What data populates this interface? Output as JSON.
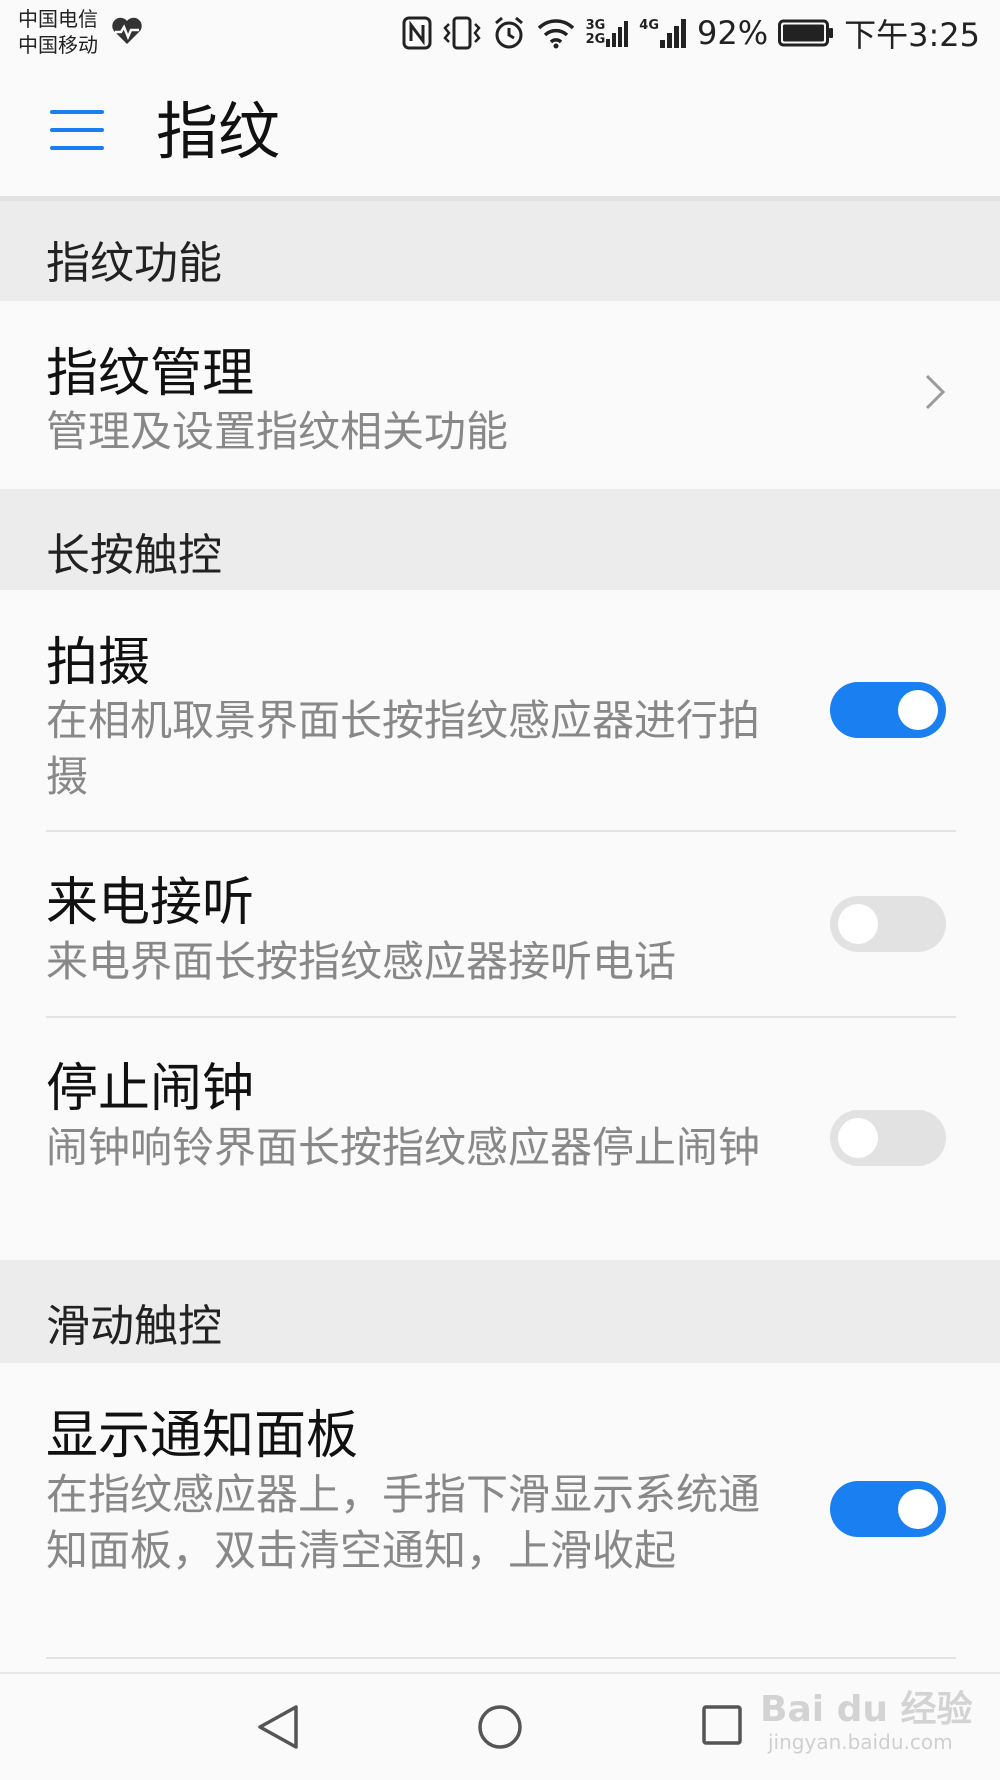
{
  "status_bar": {
    "carrier1": "中国电信",
    "carrier2": "中国移动",
    "net1": "3G",
    "net2": "2G",
    "net3": "4G",
    "battery": "92%",
    "time": "下午3:25",
    "icons": [
      "heart-rate-icon",
      "nfc-icon",
      "vibrate-icon",
      "alarm-icon",
      "wifi-icon",
      "signal-icon",
      "signal-icon",
      "battery-icon"
    ]
  },
  "header": {
    "title": "指纹",
    "menu_icon": "hamburger-menu-icon"
  },
  "sections": [
    {
      "label": "指纹功能"
    },
    {
      "label": "长按触控"
    },
    {
      "label": "滑动触控"
    }
  ],
  "rows": {
    "fingerprint_mgmt": {
      "title": "指纹管理",
      "subtitle": "管理及设置指纹相关功能"
    },
    "shoot": {
      "title": "拍摄",
      "subtitle": "在相机取景界面长按指纹感应器进行拍摄",
      "enabled": true
    },
    "answer_call": {
      "title": "来电接听",
      "subtitle": "来电界面长按指纹感应器接听电话",
      "enabled": false
    },
    "stop_alarm": {
      "title": "停止闹钟",
      "subtitle": "闹钟响铃界面长按指纹感应器停止闹钟",
      "enabled": false
    },
    "show_panel": {
      "title": "显示通知面板",
      "subtitle": "在指纹感应器上，手指下滑显示系统通知面板，双击清空通知，上滑收起",
      "enabled": true
    }
  },
  "colors": {
    "accent": "#1a7ff0",
    "toggle_off": "#e2e2e2",
    "section_bg": "#ececec"
  },
  "watermark": {
    "brand": "Bai du 经验",
    "url": "jingyan.baidu.com"
  }
}
